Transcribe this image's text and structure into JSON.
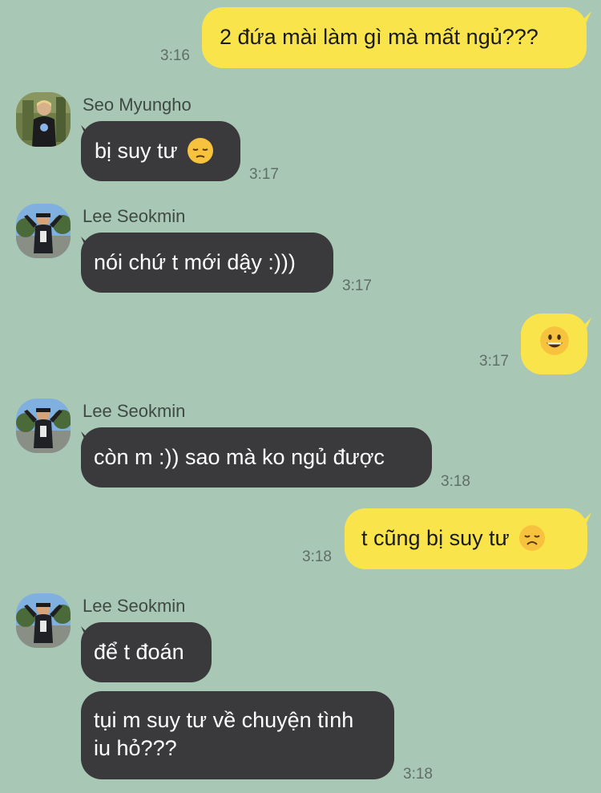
{
  "messages": [
    {
      "text": "2 đứa mài làm gì mà mất ngủ???",
      "time": "3:16"
    },
    {
      "sender": "Seo Myungho",
      "text": "bị suy tư",
      "emoji": "pensive-face",
      "time": "3:17"
    },
    {
      "sender": "Lee Seokmin",
      "text": "nói chứ t mới dậy :)))",
      "time": "3:17"
    },
    {
      "emoji": "grinning-face",
      "time": "3:17"
    },
    {
      "sender": "Lee Seokmin",
      "text": "còn m :)) sao mà ko ngủ được",
      "time": "3:18"
    },
    {
      "text": "t cũng bị suy tư",
      "emoji": "disappointed-face",
      "time": "3:18"
    },
    {
      "sender": "Lee Seokmin",
      "text": "để t đoán"
    },
    {
      "text_line1": "tụi m suy tư về chuyện tình",
      "text_line2": "iu hỏ???",
      "time": "3:18"
    }
  ],
  "colors": {
    "background": "#a9c7b5",
    "outgoing_bubble": "#f9e54b",
    "incoming_bubble": "#3a3a3c"
  }
}
